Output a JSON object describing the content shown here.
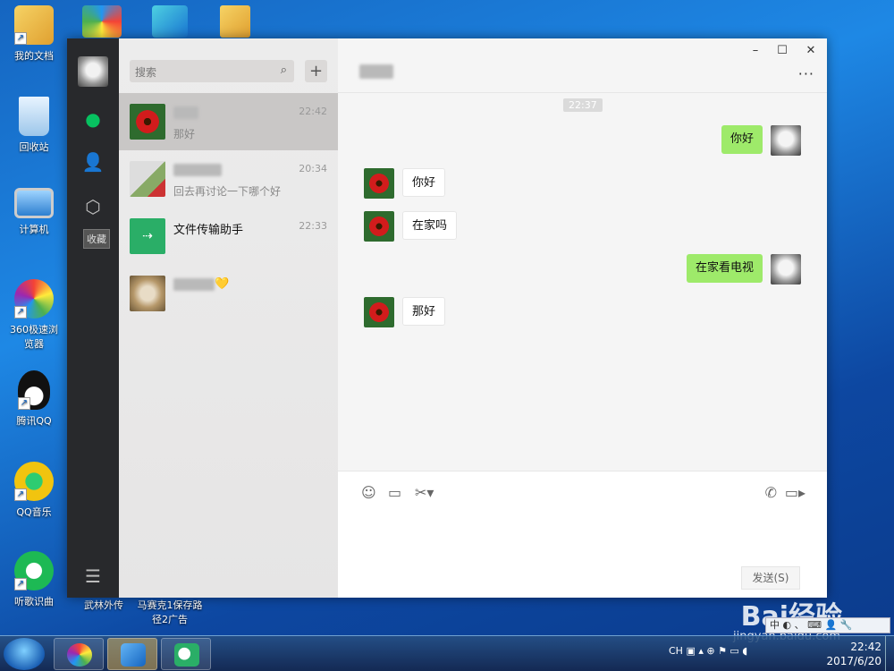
{
  "desktop": {
    "icons": [
      {
        "label": "我的文档"
      },
      {
        "label": "回收站"
      },
      {
        "label": "计算机"
      },
      {
        "label": "360极速浏览器"
      },
      {
        "label": "腾讯QQ"
      },
      {
        "label": "QQ音乐"
      },
      {
        "label": "听歌识曲"
      }
    ],
    "bottom_labels": [
      "武林外传",
      "马赛克1保存路径2广告"
    ]
  },
  "wechat": {
    "sidebar": {
      "favorites_tooltip": "收藏"
    },
    "search": {
      "placeholder": "搜索"
    },
    "chats": [
      {
        "preview": "那好",
        "time": "22:42"
      },
      {
        "preview": "回去再讨论一下哪个好",
        "time": "20:34"
      },
      {
        "name": "文件传输助手",
        "preview": "",
        "time": "22:33"
      },
      {
        "suffix": "💛"
      }
    ],
    "window_controls": {
      "minimize": "–",
      "maximize": "☐",
      "close": "✕",
      "more": "···"
    },
    "conversation": {
      "time_tag": "22:37",
      "messages": [
        {
          "from": "me",
          "text": "你好"
        },
        {
          "from": "them",
          "text": "你好"
        },
        {
          "from": "them",
          "text": "在家吗"
        },
        {
          "from": "me",
          "text": "在家看电视"
        },
        {
          "from": "them",
          "text": "那好"
        }
      ]
    },
    "input": {
      "send_label": "发送(S)"
    }
  },
  "watermark": {
    "brand": "Bai经验",
    "url": "jingyan.baidu.com"
  },
  "ime": {
    "text": "中 ◐ 、 ⌨ 👤 🔧"
  },
  "taskbar": {
    "tray_text": "CH",
    "time": "22:42",
    "date": "2017/6/20"
  }
}
